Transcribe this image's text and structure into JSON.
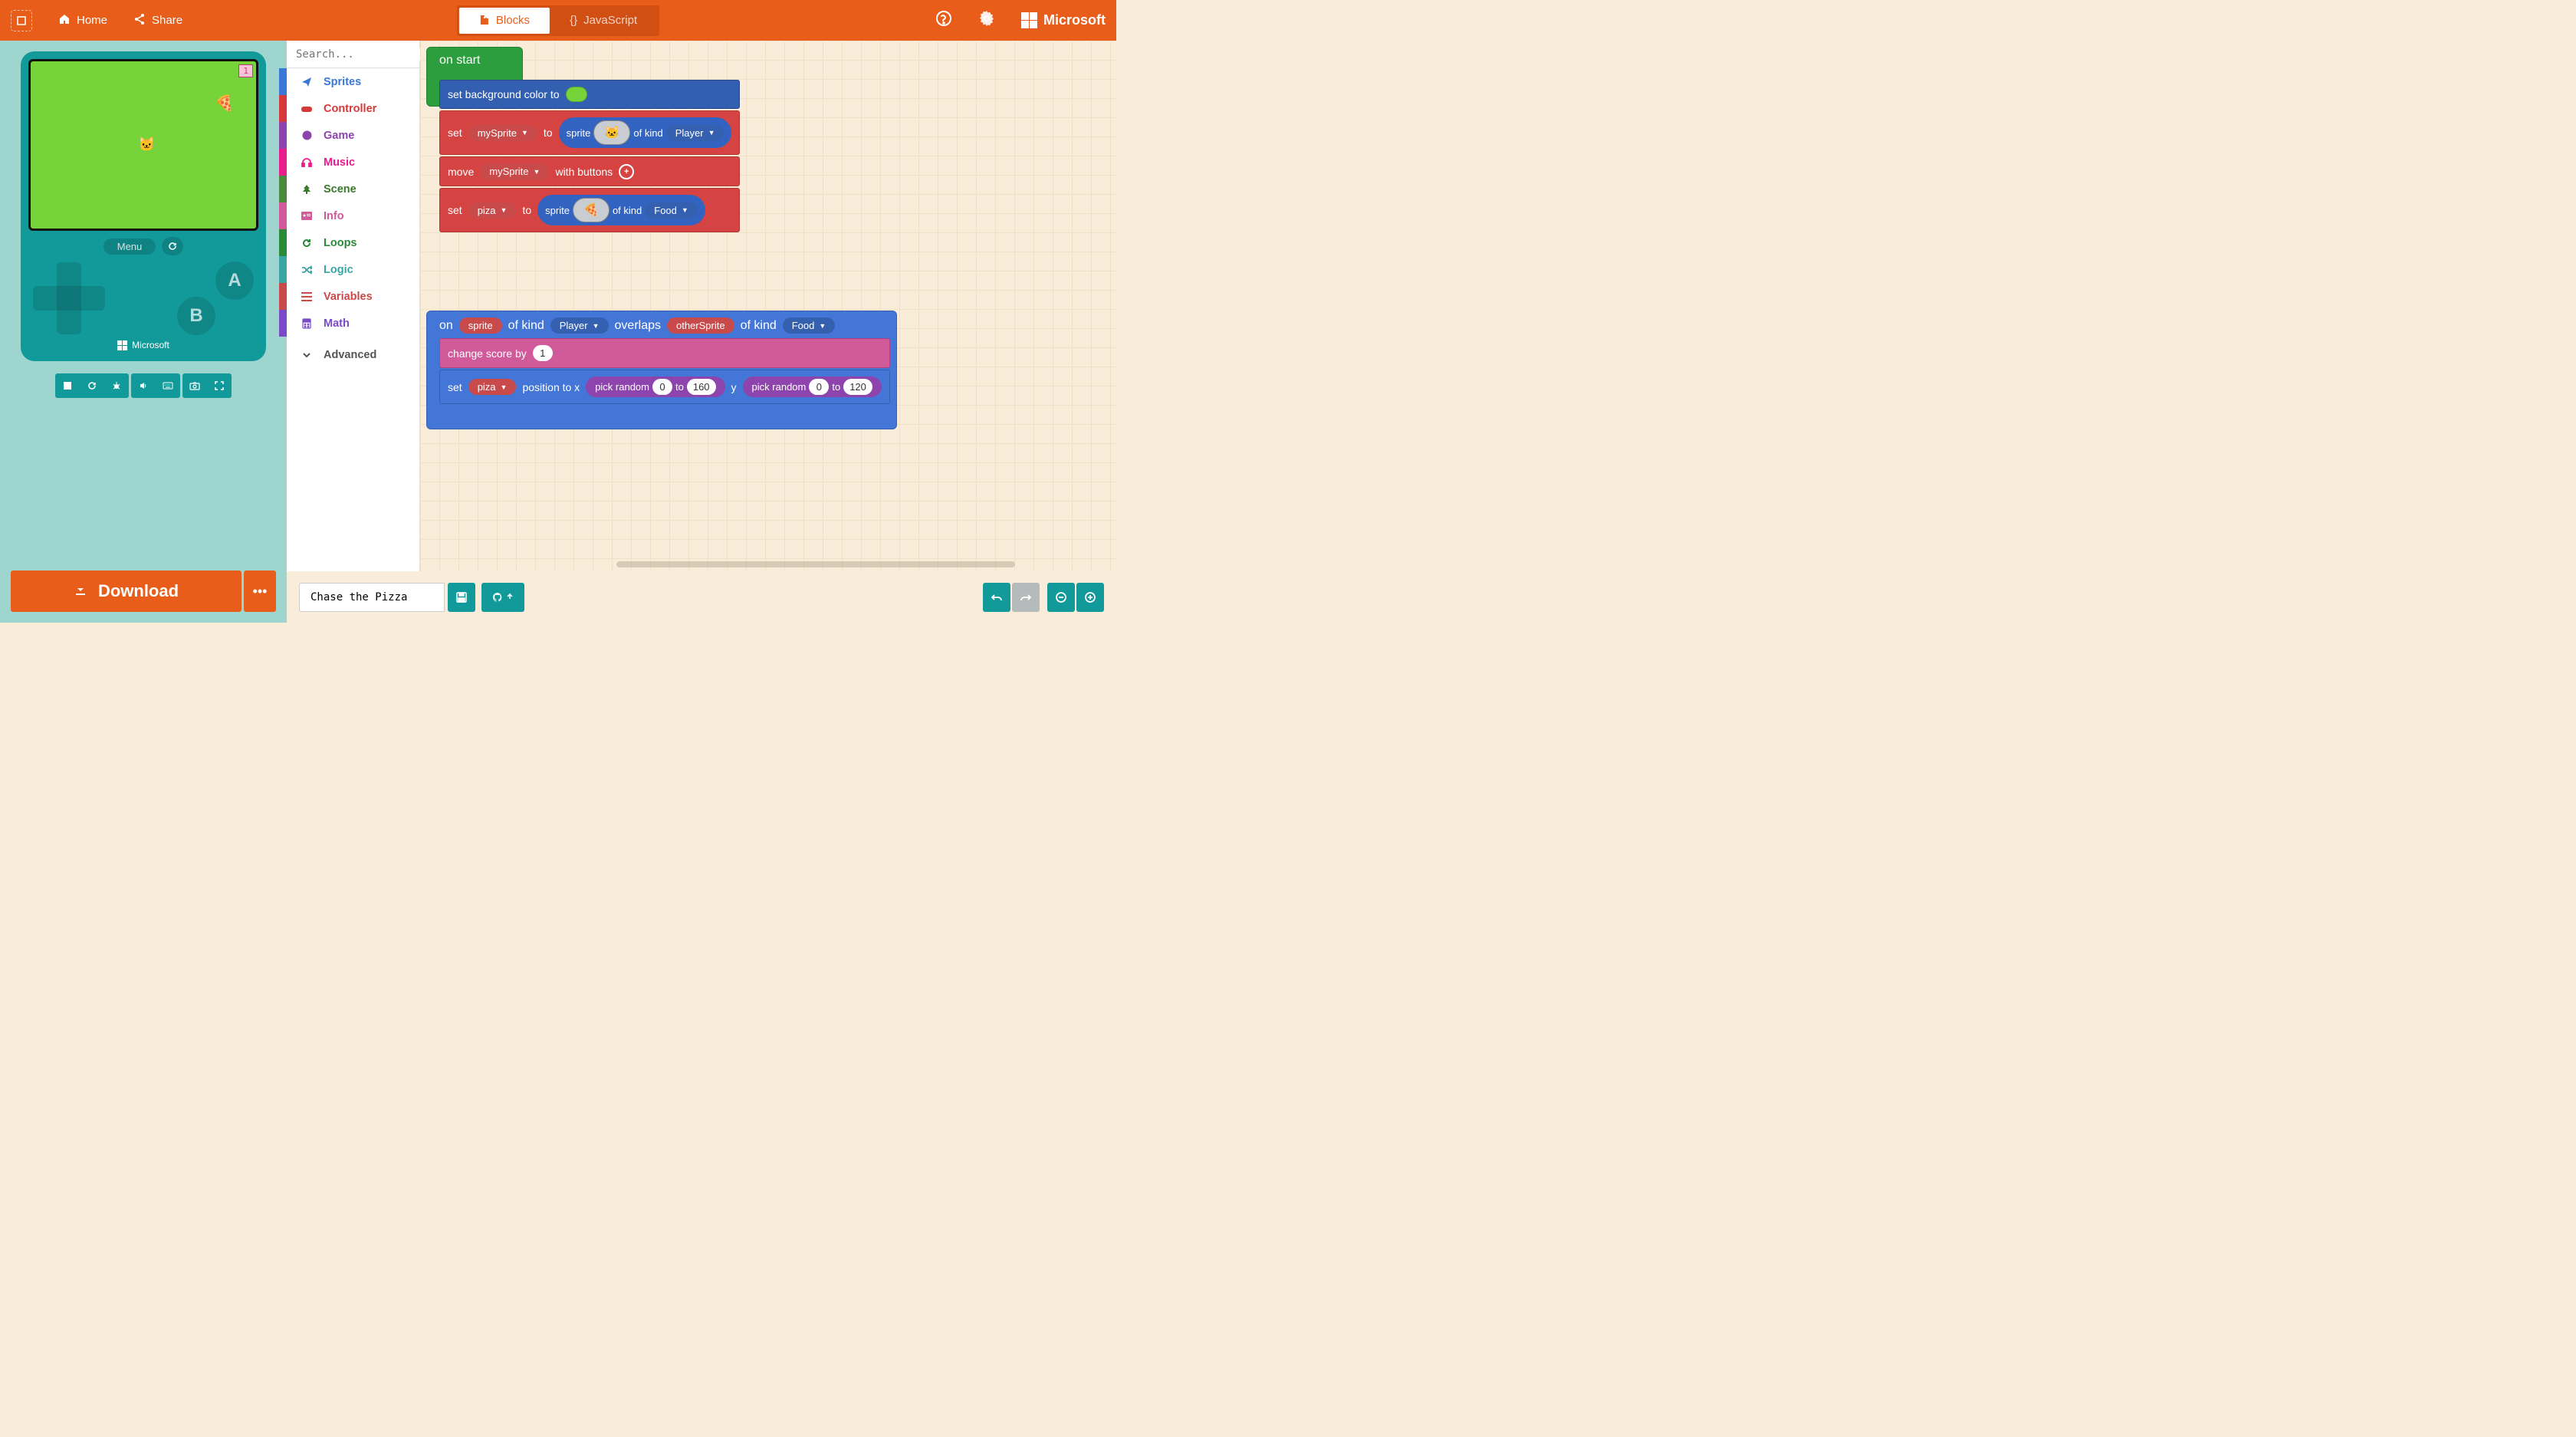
{
  "topbar": {
    "home": "Home",
    "share": "Share",
    "tab_blocks": "Blocks",
    "tab_js": "JavaScript",
    "brand": "Microsoft"
  },
  "simulator": {
    "score": "1",
    "menu": "Menu",
    "btn_a": "A",
    "btn_b": "B",
    "brand": "Microsoft"
  },
  "download": {
    "label": "Download"
  },
  "toolbox": {
    "search_placeholder": "Search...",
    "sprites": "Sprites",
    "controller": "Controller",
    "game": "Game",
    "music": "Music",
    "scene": "Scene",
    "info": "Info",
    "loops": "Loops",
    "logic": "Logic",
    "variables": "Variables",
    "math": "Math",
    "advanced": "Advanced"
  },
  "blocks": {
    "on_start": "on start",
    "set_bg": "set background color to",
    "set": "set",
    "to": "to",
    "sprite": "sprite",
    "of_kind": "of kind",
    "move": "move",
    "with_buttons": "with buttons",
    "mySprite": "mySprite",
    "piza": "piza",
    "player": "Player",
    "food": "Food",
    "on": "on",
    "sprite_word": "sprite",
    "overlaps": "overlaps",
    "otherSprite": "otherSprite",
    "change_score": "change score by",
    "score_val": "1",
    "position_to_x": "position to x",
    "pick_random": "pick random",
    "y": "y",
    "rand_x_lo": "0",
    "rand_x_hi": "160",
    "rand_y_lo": "0",
    "rand_y_hi": "120"
  },
  "bottombar": {
    "project_name": "Chase the Pizza"
  }
}
